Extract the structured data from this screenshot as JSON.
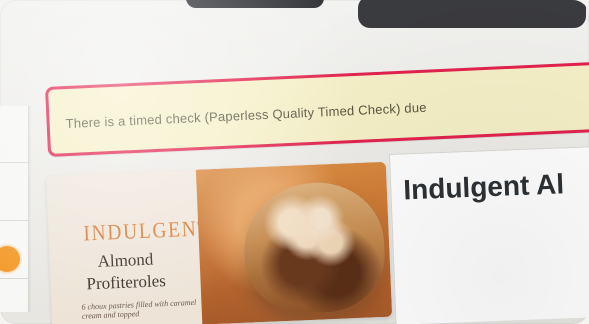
{
  "alert": {
    "message": "There is a timed check (Paperless Quality Timed Check) due"
  },
  "product": {
    "image_brand": "INDULGENT",
    "image_name_line1": "Almond",
    "image_name_line2": "Profiteroles",
    "image_small_text": "6 choux pastries filled with caramel cream and topped",
    "title": "Indulgent Al"
  },
  "colors": {
    "alert_border": "#e2234e",
    "alert_bg": "#f6f0c8",
    "indicator": "#f39a2a"
  }
}
